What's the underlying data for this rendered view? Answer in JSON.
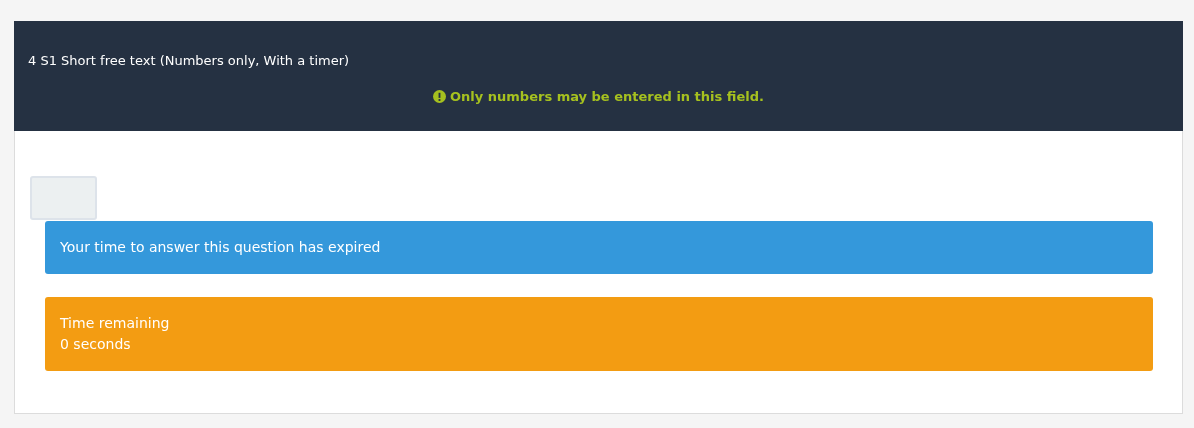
{
  "question": {
    "title": "4 S1 Short free text (Numbers only, With a timer)",
    "hint": "Only numbers may be entered in this field."
  },
  "answer": {
    "disabled": true
  },
  "alerts": [
    {
      "kind": "info",
      "lines": [
        "Your time to answer this question has expired"
      ]
    },
    {
      "kind": "warning",
      "lines": [
        "Time remaining",
        "0 seconds"
      ]
    }
  ]
}
